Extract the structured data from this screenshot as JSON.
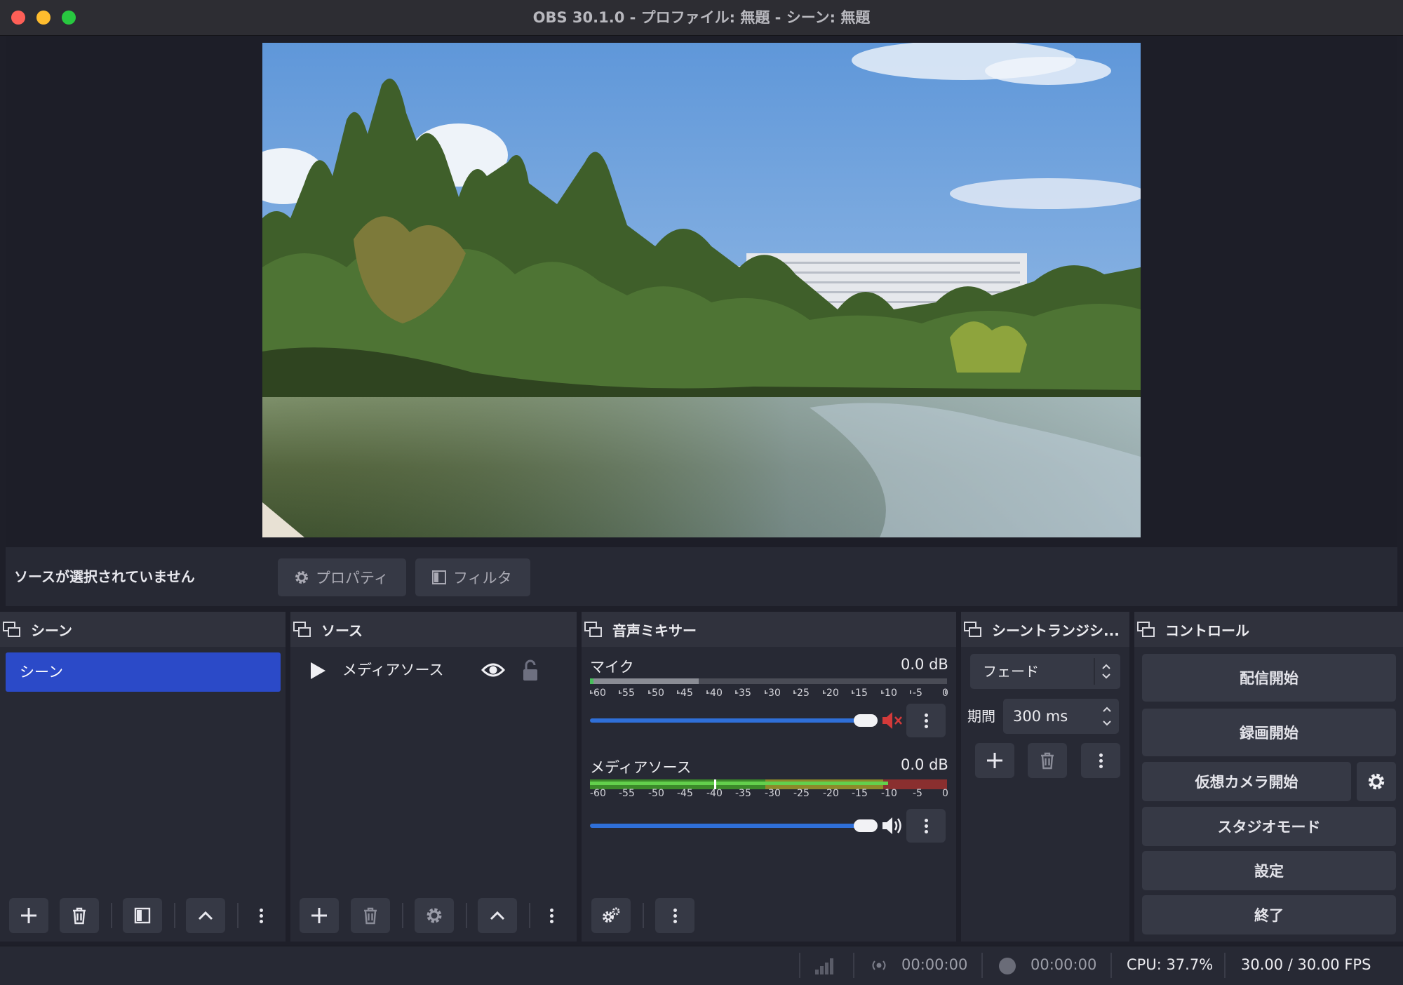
{
  "window": {
    "title": "OBS 30.1.0 - プロファイル: 無題 - シーン: 無題",
    "colors": {
      "close": "#fe5f57",
      "minimize": "#febc2e",
      "zoom": "#28c840"
    }
  },
  "context_bar": {
    "selection_text": "ソースが選択されていません",
    "properties_label": "プロパティ",
    "filters_label": "フィルタ"
  },
  "scenes": {
    "title": "シーン",
    "items": [
      {
        "label": "シーン",
        "selected": true
      }
    ]
  },
  "sources": {
    "title": "ソース",
    "items": [
      {
        "label": "メディアソース",
        "visible": true,
        "locked": false
      }
    ]
  },
  "mixer": {
    "title": "音声ミキサー",
    "scale": [
      "-60",
      "-55",
      "-50",
      "-45",
      "-40",
      "-35",
      "-30",
      "-25",
      "-20",
      "-15",
      "-10",
      "-5",
      "0"
    ],
    "channels": [
      {
        "name": "マイク",
        "db": "0.0 dB",
        "muted": true,
        "volume": 0.98
      },
      {
        "name": "メディアソース",
        "db": "0.0 dB",
        "muted": false,
        "volume": 0.98
      }
    ]
  },
  "transitions": {
    "title": "シーントランジシ...",
    "selected": "フェード",
    "duration_label": "期間",
    "duration_value": "300 ms"
  },
  "controls": {
    "title": "コントロール",
    "start_streaming": "配信開始",
    "start_recording": "録画開始",
    "start_virtual_camera": "仮想カメラ開始",
    "studio_mode": "スタジオモード",
    "settings": "設定",
    "exit": "終了"
  },
  "status": {
    "stream_time": "00:00:00",
    "record_time": "00:00:00",
    "cpu": "CPU: 37.7%",
    "fps": "30.00 / 30.00 FPS"
  },
  "icons": [
    "gear-icon",
    "filter-icon",
    "play-icon",
    "eye-icon",
    "lock-icon",
    "plus-icon",
    "trash-icon",
    "up-arrow-icon",
    "kebab-icon",
    "speaker-muted-icon",
    "speaker-icon",
    "dock-icon"
  ],
  "accent": "#2b4ac8"
}
